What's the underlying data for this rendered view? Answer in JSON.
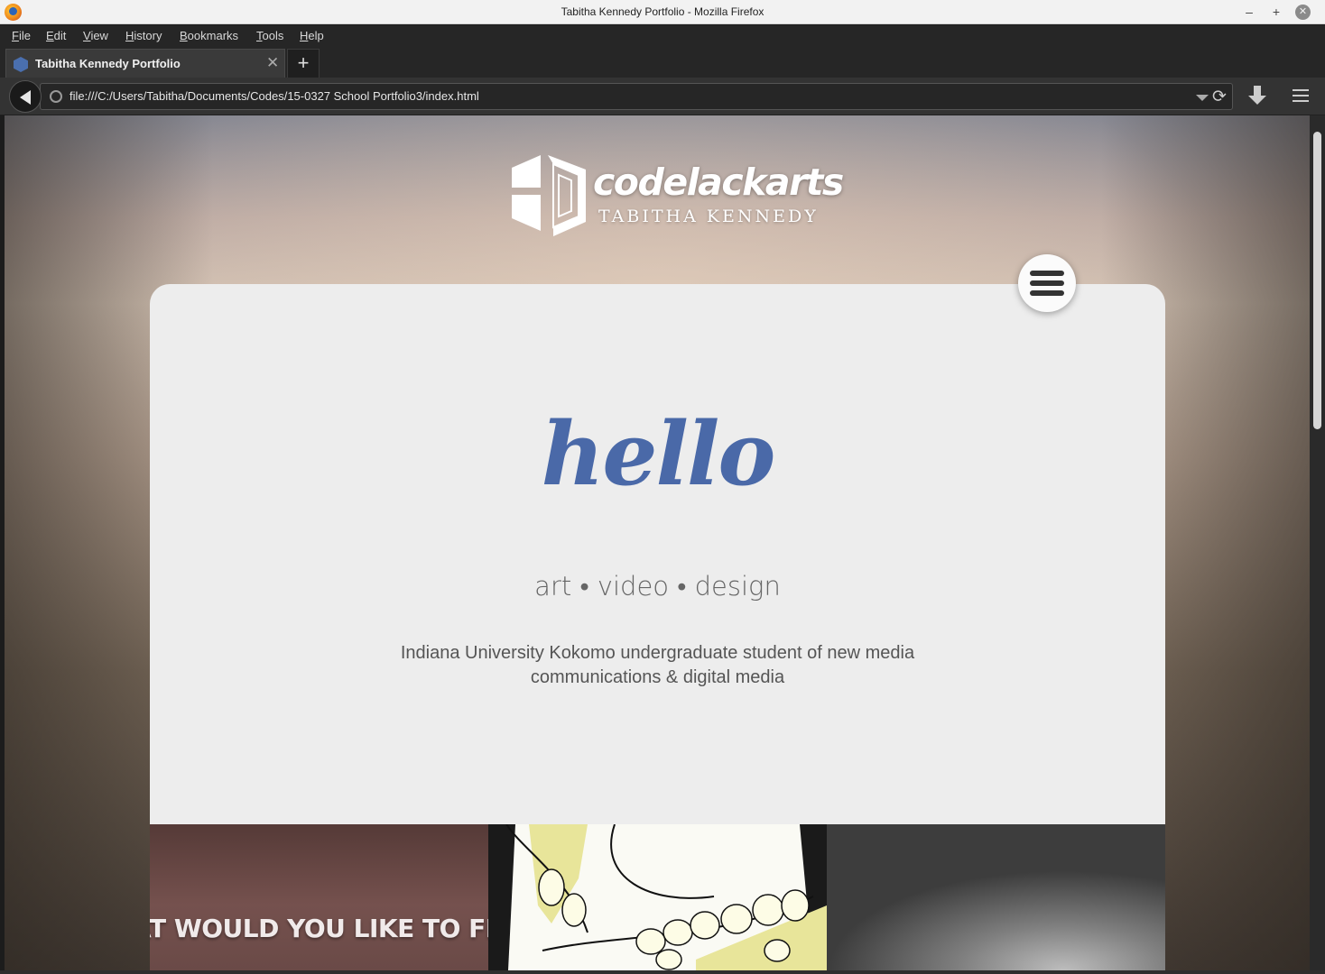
{
  "window": {
    "title": "Tabitha Kennedy Portfolio - Mozilla Firefox",
    "minimize": "–",
    "maximize": "+",
    "close": "✕"
  },
  "menu": {
    "file": "File",
    "edit": "Edit",
    "view": "View",
    "history": "History",
    "bookmarks": "Bookmarks",
    "tools": "Tools",
    "help": "Help"
  },
  "tab": {
    "title": "Tabitha Kennedy Portfolio",
    "close": "✕",
    "new_tab": "+"
  },
  "nav": {
    "url": "file:///C:/Users/Tabitha/Documents/Codes/15-0327 School Portfolio3/index.html",
    "reload": "⟳"
  },
  "page": {
    "logo_name": "codelackarts",
    "logo_subtitle": "TABITHA KENNEDY",
    "hello": "hello",
    "tagline": "art • video • design",
    "description": "Indiana University Kokomo undergraduate student of new media communications & digital media",
    "thumbnail_1_text": "AT WOULD YOU LIKE TO FI"
  },
  "colors": {
    "accent": "#4a69a8",
    "card": "#ededed",
    "chrome": "#262626"
  },
  "icons": {
    "firefox": "firefox-icon",
    "tab_favicon": "hexagon-icon",
    "back": "back-arrow-icon",
    "site_info": "info-icon",
    "dropdown": "chevron-down-icon",
    "reload": "reload-icon",
    "downloads": "download-icon",
    "menu": "hamburger-icon",
    "page_menu": "hamburger-icon"
  }
}
